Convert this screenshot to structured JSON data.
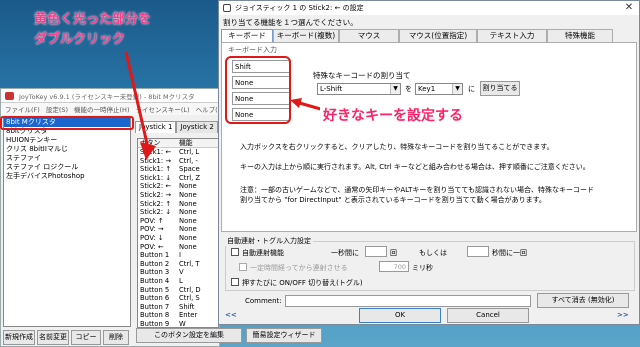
{
  "annotations": {
    "top_line1": "黄色く光った部分を",
    "top_line2": "ダブルクリック",
    "right_text": "好きなキーを設定する"
  },
  "joy_window": {
    "title": "JoyToKey v6.9.1 (ライセンスキー未登録) - 8bit Mクリスタ",
    "menus": [
      "ファイル(F)",
      "設定(S)",
      "機能の一時停止(H)",
      "ライセンスキー(L)",
      "ヘルプ(H)"
    ],
    "configs": [
      "8bit Mクリスタ",
      "8bitクリスタ",
      "HUIONテンキー",
      "クリス 8bitIIマルじ",
      "ステファイ",
      "ステファイ ロジクール",
      "左手デバイスPhotoshop"
    ],
    "tabs": [
      "Joystick 1",
      "Joystick 2"
    ],
    "table_headers": [
      "ボタン",
      "機能"
    ],
    "rows": [
      [
        "Stick1: ←",
        "Ctrl, L"
      ],
      [
        "Stick1: →",
        "Ctrl, -"
      ],
      [
        "Stick1: ↑",
        "Space"
      ],
      [
        "Stick1: ↓",
        "Ctrl, Z"
      ],
      [
        "Stick2: ←",
        "None"
      ],
      [
        "Stick2: →",
        "None"
      ],
      [
        "Stick2: ↑",
        "None"
      ],
      [
        "Stick2: ↓",
        "None"
      ],
      [
        "POV: ↑",
        "None"
      ],
      [
        "POV: →",
        "None"
      ],
      [
        "POV: ↓",
        "None"
      ],
      [
        "POV: ←",
        "None"
      ],
      [
        "Button 1",
        "I"
      ],
      [
        "Button 2",
        "Ctrl, T"
      ],
      [
        "Button 3",
        "V"
      ],
      [
        "Button 4",
        "L"
      ],
      [
        "Button 5",
        "Ctrl, D"
      ],
      [
        "Button 6",
        "Ctrl, S"
      ],
      [
        "Button 7",
        "Shift"
      ],
      [
        "Button 8",
        "Enter"
      ],
      [
        "Button 9",
        "W"
      ]
    ],
    "bottom_buttons": [
      "新規作成",
      "名前変更",
      "コピー",
      "削除"
    ],
    "edit_button": "このボタン設定を編集",
    "wizard_button": "簡易設定ウィザード"
  },
  "dialog": {
    "title": "ジョイスティック 1 の Stick2: ← の設定",
    "close_glyph": "✕",
    "instruction": "割り当てる機能を１つ選んでください。",
    "tabs": [
      "キーボード",
      "キーボード(複数)",
      "マウス",
      "マウス(位置指定)",
      "テキスト入力",
      "特殊機能"
    ],
    "key_group_label": "キーボード入力",
    "key_fields": [
      "Shift",
      "None",
      "None",
      "None"
    ],
    "special_label": "特殊なキーコードの割り当て",
    "special_select": "L-Shift",
    "wo_label": "を",
    "key_select": "Key1",
    "ni_label": "に",
    "assign_button": "割り当てる",
    "desc1": "入力ボックスを右クリックすると、クリアしたり、特殊なキーコードを割り当てることができます。",
    "desc2": "キーの入力は上から順に実行されます。Alt, Ctrl キーなどと組み合わせる場合は、押す順番にご注意ください。",
    "desc3": "注意：一部の古いゲームなどで、通常の矢印キーやALTキーを割り当てても認識されない場合、特殊なキーコード",
    "desc4": "割り当てから \"for DirectInput\" と表示されているキーコードを割り当てて動く場合があります。",
    "auto_legend": "自動連射・トグル入力設定",
    "auto_fire_label": "自動連射機能",
    "interval_label": "一秒間に",
    "times_unit": "回",
    "or_label": "もしくは",
    "seconds_label": "秒間に一回",
    "delay_label": "一定時間経ってから連射させる",
    "delay_value": "700",
    "ms_label": "ミリ秒",
    "toggle_label": "押すたびに ON/OFF 切り替え(トグル)",
    "comment_label": "Comment:",
    "clear_button": "すべて消去 (無効化)",
    "ok_button": "OK",
    "cancel_button": "Cancel",
    "prev_arrow": "<<",
    "next_arrow": ">>"
  }
}
